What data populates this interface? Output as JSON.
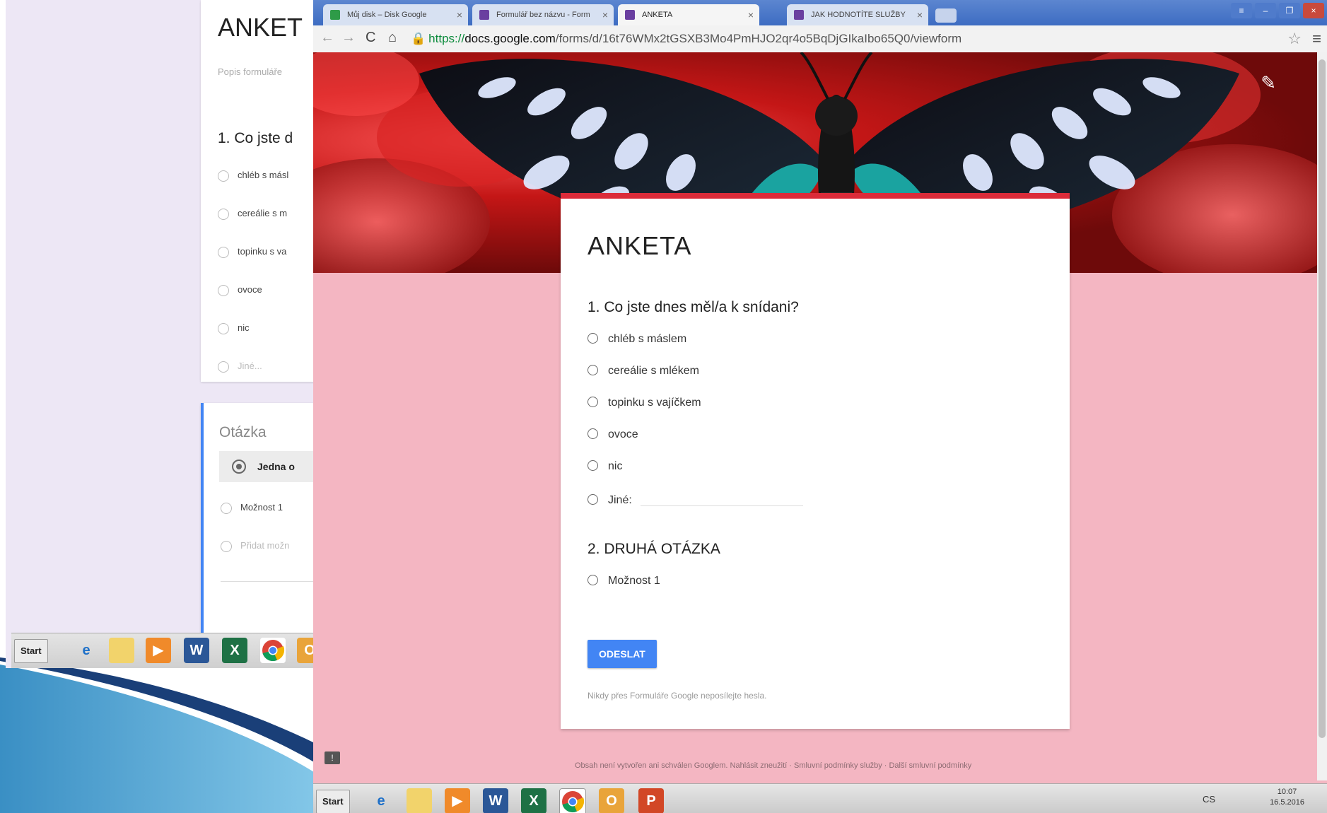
{
  "background_editor": {
    "title": "ANKET",
    "description": "Popis formuláře",
    "question": "1. Co jste d",
    "options": [
      "chléb s másl",
      "cereálie s m",
      "topinku s va",
      "ovoce",
      "nic",
      "Jiné..."
    ],
    "question_label": "Otázka",
    "question_type": "Jedna o",
    "new_options": [
      "Možnost 1",
      "Přidat možn"
    ],
    "taskbar_start": "Start"
  },
  "browser": {
    "tabs": [
      {
        "label": "Můj disk – Disk Google",
        "icon": "google-drive-icon",
        "color": "#2e9b48"
      },
      {
        "label": "Formulář bez názvu - Form",
        "icon": "forms-icon",
        "color": "#6a3fa0"
      },
      {
        "label": "ANKETA",
        "icon": "forms-icon",
        "color": "#6a3fa0"
      },
      {
        "label": "JAK HODNOTÍTE SLUŽBY",
        "icon": "forms-icon",
        "color": "#6a3fa0"
      }
    ],
    "active_tab": 2,
    "url_scheme": "https://",
    "url_host": "docs.google.com",
    "url_path": "/forms/d/16t76WMx2tGSXB3Mo4PmHJO2qr4o5BqDjGIkaIbo65Q0/viewform"
  },
  "form": {
    "title": "ANKETA",
    "q1": {
      "title": "1. Co jste dnes měl/a k snídani?",
      "options": [
        "chléb s máslem",
        "cereálie s mlékem",
        "topinku s vajíčkem",
        "ovoce",
        "nic"
      ],
      "other_label": "Jiné:"
    },
    "q2": {
      "title": "2. DRUHÁ OTÁZKA",
      "options": [
        "Možnost 1"
      ]
    },
    "submit_label": "ODESLAT",
    "warning": "Nikdy přes Formuláře Google neposílejte hesla.",
    "footer": "Obsah není vytvořen ani schválen Googlem. Nahlásit zneužití · Smluvní podmínky služby · Další smluvní podmínky",
    "accent_color": "#db2b39",
    "button_color": "#4285f4",
    "page_bg": "#f4b6c2"
  },
  "taskbar": {
    "start": "Start",
    "lang": "CS",
    "time": "10:07",
    "date": "16.5.2016"
  }
}
